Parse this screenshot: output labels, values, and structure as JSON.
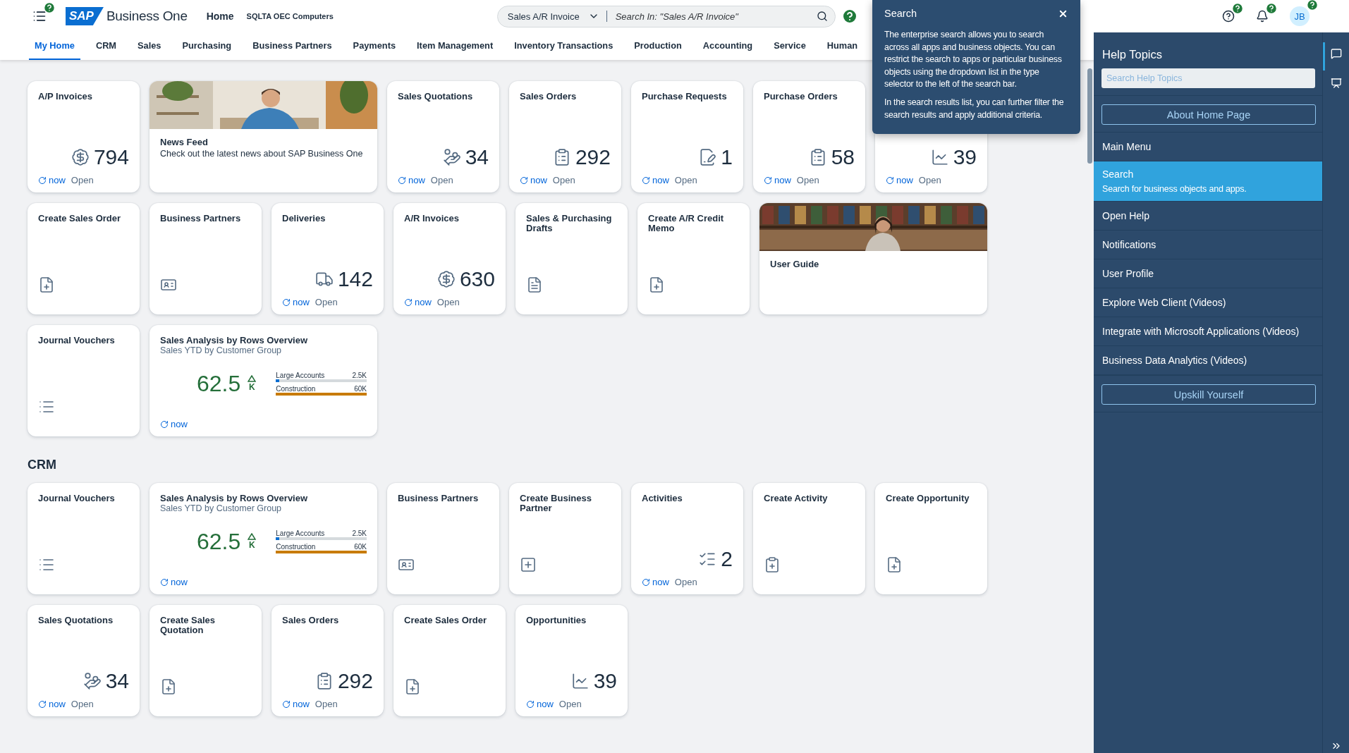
{
  "header": {
    "logo_text": "SAP",
    "app_name": "Business One",
    "page": "Home",
    "company": "SQLTA OEC Computers",
    "search": {
      "scope": "Sales A/R Invoice",
      "placeholder": "Search In: \"Sales A/R Invoice\""
    },
    "avatar": "JB"
  },
  "tabs": [
    {
      "label": "My Home",
      "selected": true
    },
    {
      "label": "CRM",
      "selected": false
    },
    {
      "label": "Sales",
      "selected": false
    },
    {
      "label": "Purchasing",
      "selected": false
    },
    {
      "label": "Business Partners",
      "selected": false
    },
    {
      "label": "Payments",
      "selected": false
    },
    {
      "label": "Item Management",
      "selected": false
    },
    {
      "label": "Inventory Transactions",
      "selected": false
    },
    {
      "label": "Production",
      "selected": false
    },
    {
      "label": "Accounting",
      "selected": false
    },
    {
      "label": "Service",
      "selected": false
    },
    {
      "label": "Human",
      "selected": false
    }
  ],
  "sections": [
    {
      "tiles": [
        {
          "kind": "kpi",
          "title": "A/P Invoices",
          "value": "794",
          "refresh": "now",
          "action": "Open"
        },
        {
          "kind": "news",
          "title": "News Feed",
          "subtitle": "Check out the latest news about SAP Business One"
        },
        {
          "kind": "kpi",
          "title": "Sales Quotations",
          "value": "34",
          "refresh": "now",
          "action": "Open"
        },
        {
          "kind": "kpi",
          "title": "Sales Orders",
          "value": "292",
          "refresh": "now",
          "action": "Open"
        },
        {
          "kind": "kpi",
          "title": "Purchase Requests",
          "value": "1",
          "refresh": "now",
          "action": "Open"
        },
        {
          "kind": "kpi",
          "title": "Purchase Orders",
          "value": "58",
          "refresh": "now",
          "action": "Open"
        },
        {
          "kind": "kpi",
          "value": "39",
          "refresh": "now",
          "action": "Open"
        },
        {
          "kind": "launch",
          "title": "Create Sales Order"
        },
        {
          "kind": "launch",
          "title": "Business Partners"
        },
        {
          "kind": "kpi",
          "title": "Deliveries",
          "value": "142",
          "refresh": "now",
          "action": "Open"
        },
        {
          "kind": "kpi",
          "title": "A/R Invoices",
          "value": "630",
          "refresh": "now",
          "action": "Open"
        },
        {
          "kind": "launch",
          "title": "Sales & Purchasing Drafts"
        },
        {
          "kind": "launch",
          "title": "Create A/R Credit Memo"
        },
        {
          "kind": "guide",
          "title": "User Guide"
        },
        {
          "kind": "launch",
          "title": "Journal Vouchers"
        },
        {
          "kind": "chart",
          "title": "Sales Analysis by Rows Overview",
          "subtitle": "Sales YTD by Customer Group",
          "value": "62.5",
          "unit": "K",
          "refresh": "now",
          "bars": [
            {
              "label": "Large Accounts",
              "value": "2.5K",
              "level": 0.04,
              "color": "#0a6ed1"
            },
            {
              "label": "Construction",
              "value": "60K",
              "level": 1,
              "color": "#c87b00"
            }
          ]
        }
      ]
    },
    {
      "heading": "CRM",
      "tiles": [
        {
          "kind": "launch",
          "title": "Journal Vouchers"
        },
        {
          "kind": "chart",
          "title": "Sales Analysis by Rows Overview",
          "subtitle": "Sales YTD by Customer Group",
          "value": "62.5",
          "unit": "K",
          "refresh": "now",
          "bars": [
            {
              "label": "Large Accounts",
              "value": "2.5K",
              "level": 0.04,
              "color": "#0a6ed1"
            },
            {
              "label": "Construction",
              "value": "60K",
              "level": 1,
              "color": "#c87b00"
            }
          ]
        },
        {
          "kind": "launch",
          "title": "Business Partners"
        },
        {
          "kind": "launch",
          "title": "Create Business Partner"
        },
        {
          "kind": "kpi",
          "title": "Activities",
          "value": "2",
          "refresh": "now",
          "action": "Open"
        },
        {
          "kind": "launch",
          "title": "Create Activity"
        },
        {
          "kind": "launch",
          "title": "Create Opportunity"
        },
        {
          "kind": "kpi",
          "title": "Sales Quotations",
          "value": "34",
          "refresh": "now",
          "action": "Open"
        },
        {
          "kind": "launch",
          "title": "Create Sales Quotation"
        },
        {
          "kind": "kpi",
          "title": "Sales Orders",
          "value": "292",
          "refresh": "now",
          "action": "Open"
        },
        {
          "kind": "launch",
          "title": "Create Sales Order"
        },
        {
          "kind": "kpi",
          "title": "Opportunities",
          "value": "39",
          "refresh": "now",
          "action": "Open"
        }
      ]
    }
  ],
  "tooltip": {
    "title": "Search",
    "paragraphs": [
      "The enterprise search allows you to search across all apps and business objects. You can restrict the search to apps or particular business objects using the dropdown list in the type selector to the left of the search bar.",
      "In the search results list, you can further filter the search results and apply additional criteria."
    ]
  },
  "help_panel": {
    "title": "Help Topics",
    "search": {
      "placeholder": "Search Help Topics"
    },
    "items": [
      {
        "kind": "button",
        "label": "About Home Page"
      },
      {
        "kind": "topic",
        "label": "Main Menu",
        "selected": false
      },
      {
        "kind": "topic",
        "label": "Search",
        "description": "Search for business objects and apps.",
        "selected": true
      },
      {
        "kind": "topic",
        "label": "Open Help",
        "selected": false
      },
      {
        "kind": "topic",
        "label": "Notifications",
        "selected": false
      },
      {
        "kind": "topic",
        "label": "User Profile",
        "selected": false
      },
      {
        "kind": "topic",
        "label": "Explore Web Client (Videos)",
        "selected": false
      },
      {
        "kind": "topic",
        "label": "Integrate with Microsoft Applications (Videos)",
        "selected": false
      },
      {
        "kind": "topic",
        "label": "Business Data Analytics (Videos)",
        "selected": false
      },
      {
        "kind": "button",
        "label": "Upskill Yourself"
      }
    ]
  }
}
